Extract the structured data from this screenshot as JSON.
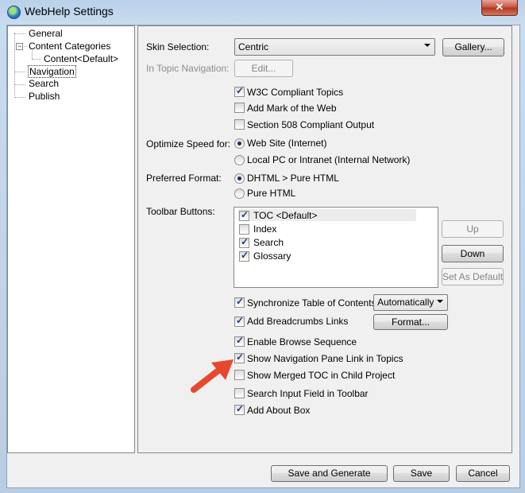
{
  "window": {
    "title": "WebHelp Settings",
    "close_glyph": "✕"
  },
  "tree": {
    "items": [
      {
        "label": "General"
      },
      {
        "label": "Content Categories"
      },
      {
        "label": "Content<Default>"
      },
      {
        "label": "Navigation"
      },
      {
        "label": "Search"
      },
      {
        "label": "Publish"
      }
    ],
    "expand_glyph": "−"
  },
  "panel": {
    "skin_selection_label": "Skin Selection:",
    "skin_value": "Centric",
    "gallery_label": "Gallery...",
    "in_topic_nav_label": "In Topic Navigation:",
    "edit_label": "Edit...",
    "w3c_label": "W3C Compliant Topics",
    "w3c_checked": true,
    "mark_of_web_label": "Add Mark of the Web",
    "mark_of_web_checked": false,
    "section508_label": "Section 508 Compliant Output",
    "section508_checked": false,
    "optimize_label": "Optimize Speed for:",
    "opt_web_label": "Web Site (Internet)",
    "opt_local_label": "Local PC or Intranet (Internal Network)",
    "optimize_selected": "web",
    "preferred_format_label": "Preferred Format:",
    "fmt_dhtml_label": "DHTML > Pure HTML",
    "fmt_pure_label": "Pure HTML",
    "format_selected": "dhtml",
    "toolbar_buttons_label": "Toolbar Buttons:",
    "toolbar_items": [
      {
        "label": "TOC <Default>",
        "checked": true
      },
      {
        "label": "Index",
        "checked": false
      },
      {
        "label": "Search",
        "checked": true
      },
      {
        "label": "Glossary",
        "checked": true
      }
    ],
    "up_label": "Up",
    "down_label": "Down",
    "set_default_label": "Set As Default",
    "sync_toc_label": "Synchronize Table of Contents",
    "sync_toc_checked": true,
    "sync_mode_value": "Automatically",
    "breadcrumbs_label": "Add Breadcrumbs Links",
    "breadcrumbs_checked": true,
    "format_btn_label": "Format...",
    "browse_seq_label": "Enable Browse Sequence",
    "browse_seq_checked": true,
    "show_nav_link_label": "Show Navigation Pane Link in Topics",
    "show_nav_link_checked": true,
    "merged_toc_label": "Show Merged TOC in Child Project",
    "merged_toc_checked": false,
    "search_input_label": "Search Input Field in Toolbar",
    "search_input_checked": false,
    "about_box_label": "Add About Box",
    "about_box_checked": true
  },
  "footer": {
    "save_generate_label": "Save and Generate",
    "save_label": "Save",
    "cancel_label": "Cancel"
  },
  "tick_glyph": "✓",
  "colors": {
    "annotation_arrow": "#e8472f"
  }
}
